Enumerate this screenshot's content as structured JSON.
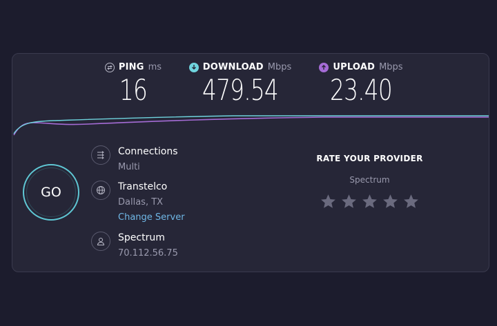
{
  "metrics": {
    "ping": {
      "label": "PING",
      "unit": "ms",
      "value": "16"
    },
    "download": {
      "label": "DOWNLOAD",
      "unit": "Mbps",
      "value": "479.54"
    },
    "upload": {
      "label": "UPLOAD",
      "unit": "Mbps",
      "value": "23.40"
    }
  },
  "go_button": {
    "label": "GO"
  },
  "connections": {
    "title": "Connections",
    "value": "Multi"
  },
  "server": {
    "title": "Transtelco",
    "location": "Dallas, TX",
    "change_link": "Change Server"
  },
  "isp": {
    "title": "Spectrum",
    "ip": "70.112.56.75"
  },
  "rating": {
    "title": "RATE YOUR PROVIDER",
    "provider": "Spectrum",
    "stars": 5,
    "filled": 0
  },
  "colors": {
    "download": "#6fd4de",
    "upload": "#a56cd6",
    "background": "#1c1c2d",
    "panel": "#262637",
    "link": "#6fb7e6"
  },
  "icons": {
    "ping": "ping-icon",
    "download": "download-arrow-icon",
    "upload": "upload-arrow-icon",
    "connections": "connections-icon",
    "server": "globe-icon",
    "isp": "user-icon",
    "star": "star-icon"
  }
}
